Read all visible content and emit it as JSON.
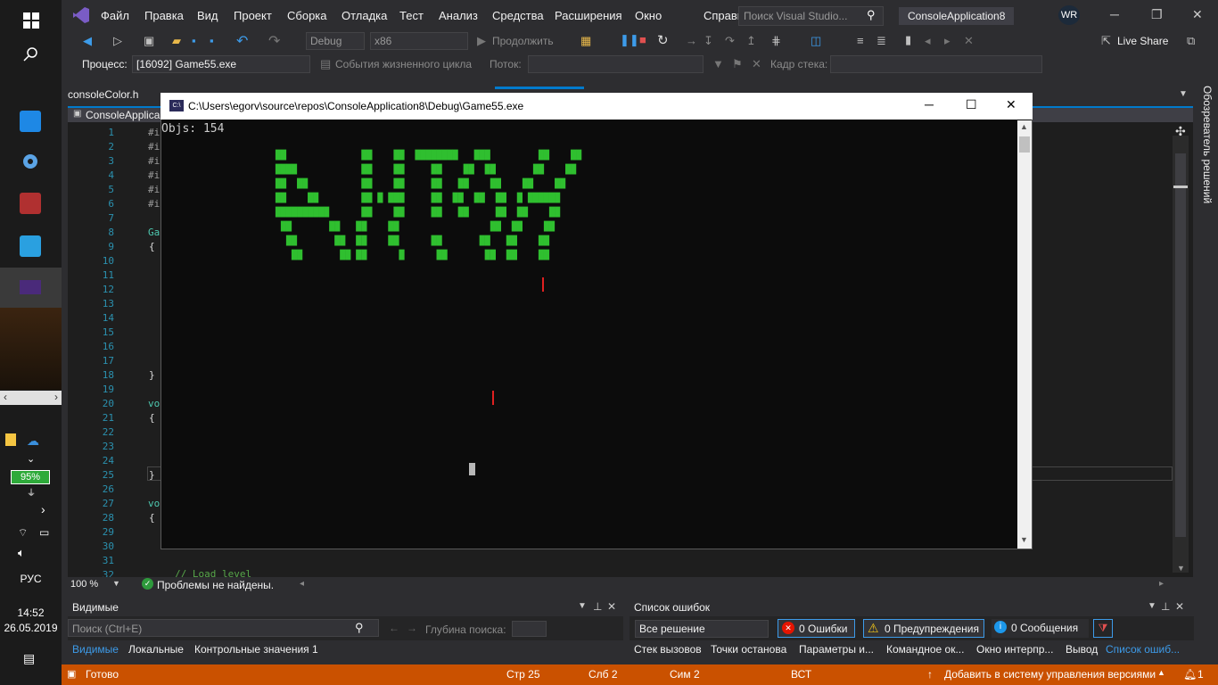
{
  "taskbar": {
    "battery": "95%",
    "language": "РУС",
    "time": "14:52",
    "date": "26.05.2019"
  },
  "menubar": {
    "items": [
      "Файл",
      "Правка",
      "Вид",
      "Проект",
      "Сборка",
      "Отладка",
      "Тест",
      "Анализ",
      "Средства",
      "Расширения",
      "Окно",
      "Справка"
    ],
    "search_placeholder": "Поиск Visual Studio...",
    "solution_title": "ConsoleApplication8",
    "user_initials": "WR"
  },
  "toolbar": {
    "config": "Debug",
    "platform": "x86",
    "continue": "Продолжить",
    "live_share": "Live Share",
    "process_label": "Процесс:",
    "process_value": "[16092] Game55.exe",
    "lifecycle": "События жизненного цикла",
    "thread_label": "Поток:",
    "stack_label": "Кадр стека:"
  },
  "tabs": {
    "file_tab": "consoleColor.h",
    "doc_tab": "ConsoleApplica"
  },
  "editor": {
    "line_numbers": [
      "1",
      "2",
      "3",
      "4",
      "5",
      "6",
      "7",
      "8",
      "9",
      "10",
      "11",
      "12",
      "13",
      "14",
      "15",
      "16",
      "17",
      "18",
      "19",
      "20",
      "21",
      "22",
      "23",
      "24",
      "25",
      "26",
      "27",
      "28",
      "29",
      "30",
      "31",
      "32"
    ],
    "zoom": "100 %",
    "problems": "Проблемы не найдены.",
    "comment_line": "// Load level",
    "code_prefixes": [
      "#i",
      "#i",
      "#i",
      "#i",
      "#i",
      "#i",
      "Ga",
      "{",
      "}",
      "vo",
      "{",
      "}",
      "vo",
      "{"
    ]
  },
  "right_rail": {
    "label": "Обозреватель решений"
  },
  "console": {
    "title": "C:\\Users\\egorv\\source\\repos\\ConsoleApplication8\\Debug\\Game55.exe",
    "objs": "Objs: 154",
    "glyph_rows": [
      "██              ██    ██  ████████   ███         ██    ██",
      "████            ██    ██     ██    ██  ██       ██    ██",
      "██  ██          ██    ██     ██   ██    ██    ██    ██",
      "██    ██        ██ █ ███     ██  ██  ██  ██  █ ██████",
      "██████████      ██    ██     ██   ██     ██  ██    ██",
      " ██       ██   ██    ██                 ██  ██    ██",
      "  ██       ██  ██    ██      ██       ██   ██    ██",
      "   ██       ██ ██      █      ██       ██  ██    ██"
    ]
  },
  "bottom_left": {
    "title": "Видимые",
    "search_placeholder": "Поиск (Ctrl+E)",
    "depth_label": "Глубина поиска:",
    "tabs": [
      "Видимые",
      "Локальные",
      "Контрольные значения 1"
    ]
  },
  "bottom_right": {
    "title": "Список ошибок",
    "filter": "Все решение",
    "errors": "0 Ошибки",
    "warnings": "0 Предупреждения",
    "messages": "0 Сообщения",
    "tabs": [
      "Стек вызовов",
      "Точки останова",
      "Параметры и...",
      "Командное ок...",
      "Окно интерпр...",
      "Вывод",
      "Список ошиб..."
    ]
  },
  "statusbar": {
    "ready": "Готово",
    "line": "Стр 25",
    "col": "Слб 2",
    "char": "Сим 2",
    "mode": "ВСТ",
    "source_control": "Добавить в систему управления версиями",
    "notifications": "1"
  },
  "colors": {
    "accent": "#007acc",
    "status_bar": "#ca5100",
    "console_glyph": "#2fbf2f"
  }
}
